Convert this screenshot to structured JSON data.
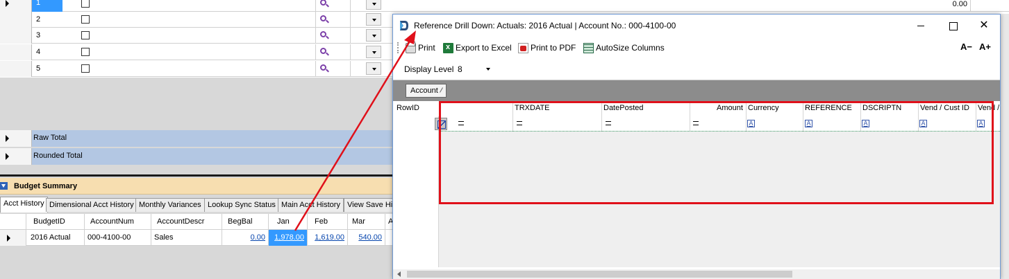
{
  "background_grid": {
    "rows": [
      {
        "num": "1",
        "selected": true,
        "value": "0.00"
      },
      {
        "num": "2"
      },
      {
        "num": "3"
      },
      {
        "num": "4"
      },
      {
        "num": "5"
      }
    ],
    "raw_total_label": "Raw Total",
    "rounded_total_label": "Rounded Total"
  },
  "budget_summary": {
    "title": "Budget Summary",
    "tabs": [
      "Acct History",
      "Dimensional Acct History",
      "Monthly Variances",
      "Lookup Sync Status",
      "Main Acct History",
      "View Save His"
    ],
    "active_tab": "Acct History",
    "columns": [
      "BudgetID",
      "AccountNum",
      "AccountDescr",
      "BegBal",
      "Jan",
      "Feb",
      "Mar",
      "A"
    ],
    "row": {
      "budget_id": "2016 Actual",
      "account_num": "000-4100-00",
      "account_descr": "Sales",
      "beg_bal": "0.00",
      "jan": "1,978.00",
      "feb": "1,619.00",
      "mar": "540.00"
    }
  },
  "dialog": {
    "title": "Reference Drill Down: Actuals: 2016 Actual |  Account No.: 000-4100-00",
    "toolbar": {
      "print": "Print",
      "export_excel": "Export to Excel",
      "print_pdf": "Print to PDF",
      "autosize": "AutoSize Columns",
      "font_decrease": "A−",
      "font_increase": "A+"
    },
    "display_level_label": "Display Level",
    "display_level_value": "8",
    "group_by_chip": "Account",
    "columns": [
      "RowID",
      "TRXDATE",
      "DatePosted",
      "Amount",
      "Currency",
      "REFERENCE",
      "DSCRIPTN",
      "Vend / Cust ID",
      "Vend /"
    ]
  },
  "colors": {
    "highlight_blue": "#3399ff",
    "total_row_blue": "#b3c7e3",
    "budget_header": "#f7deb0",
    "annotation_red": "#e0101a"
  }
}
